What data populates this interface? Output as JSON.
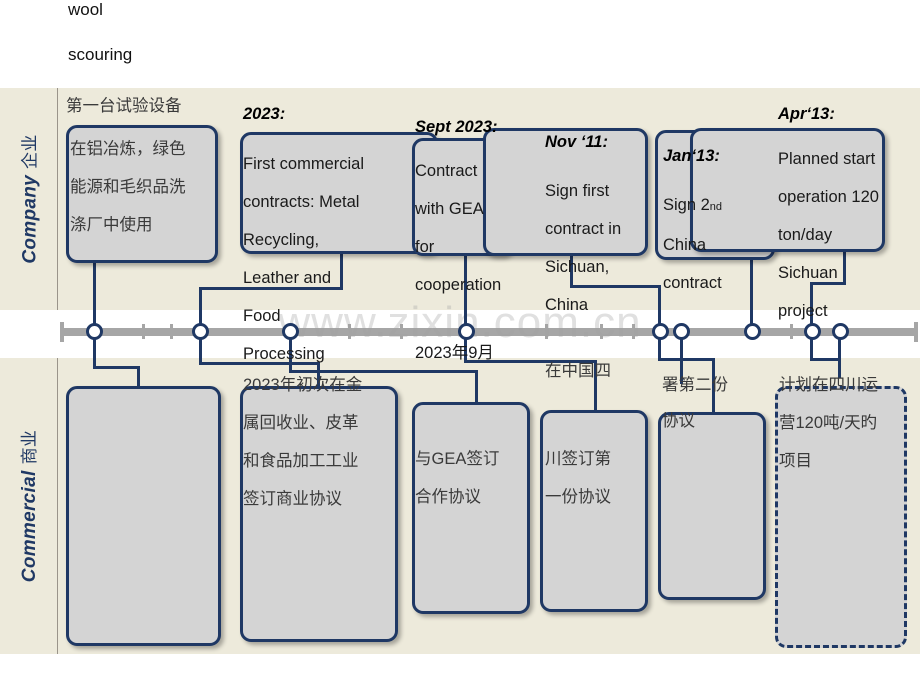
{
  "captions": {
    "wool": "wool",
    "scouring": "scouring"
  },
  "watermark": "www.zixin.com.cn",
  "lanes": {
    "company": {
      "label_en": "Company",
      "label_cn": "企业"
    },
    "commercial": {
      "label_en": "Commercial",
      "label_cn": "商业"
    }
  },
  "colors": {
    "band": "#EDEADB",
    "box_fill": "#D4D4D4",
    "box_border": "#1F3864",
    "axis": "#A6A6A6",
    "accent": "#1F3864"
  },
  "company_events": [
    {
      "header": "第一台试验设备",
      "header_style": "cn",
      "body": "在铝冶炼，绿色\n能源和毛织品洗\n涤厂中使用"
    },
    {
      "header": "2023:",
      "header_style": "en",
      "body": "First commercial\ncontracts: Metal\nRecycling,\nLeather and\nFood\nProcessing"
    },
    {
      "header": "Sept 2023:",
      "header_style": "en",
      "body": "Contract\nwith GEA\nfor\ncooperation"
    },
    {
      "header": "Nov ‘11:",
      "header_style": "en",
      "body": "Sign first\ncontract in\nSichuan,\nChina"
    },
    {
      "header": "Jan‘13:",
      "header_style": "en",
      "body_line1": "Sign 2",
      "body_sup": "nd",
      "body_rest": "\nChina\ncontract"
    },
    {
      "header": "Apr‘13:",
      "header_style": "en",
      "body": "Planned start\noperation 120\nton/day\nSichuan\nproject"
    }
  ],
  "commercial_events": [
    {
      "body": ""
    },
    {
      "body": "2023年初次在金\n属回收业、皮革\n和食品加工工业\n签订商业协议"
    },
    {
      "body": "与GEA签订\n合作协议"
    },
    {
      "body": "川签订第\n一份协议"
    },
    {
      "body": "协议"
    },
    {
      "body": "计划在四川运\n营120吨/天旳\n项目"
    }
  ],
  "commercial_overflow": [
    {
      "text": "2023年9月"
    },
    {
      "text": "在中国四"
    },
    {
      "text": "署第二份"
    }
  ],
  "axis": {
    "node_count": 8,
    "nodes": [
      95,
      200,
      290,
      466,
      660,
      682,
      752,
      812,
      840
    ]
  }
}
